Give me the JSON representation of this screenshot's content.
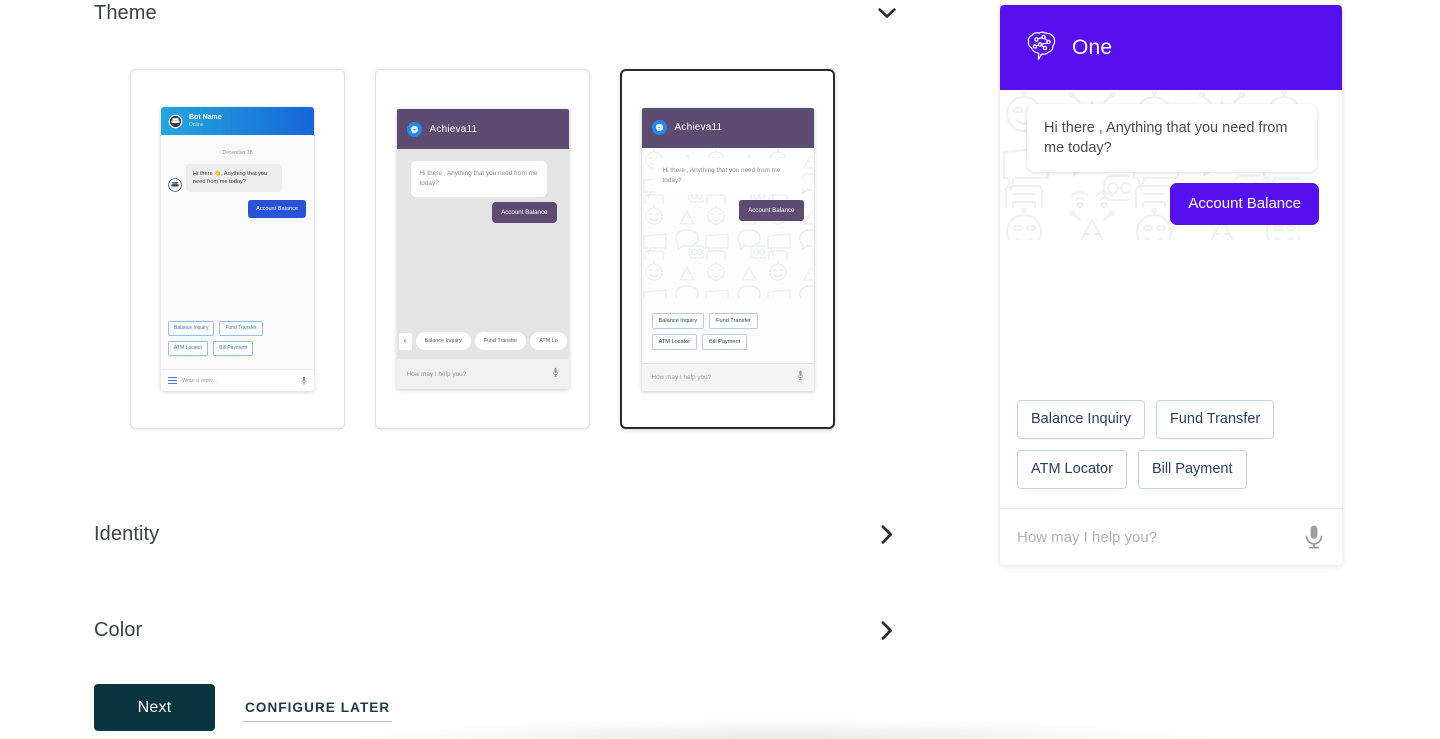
{
  "sections": {
    "theme": {
      "title": "Theme",
      "chevron": "chevron-down-icon",
      "expanded": true
    },
    "identity": {
      "title": "Identity",
      "chevron": "chevron-right-icon",
      "expanded": false
    },
    "color": {
      "title": "Color",
      "chevron": "chevron-right-icon",
      "expanded": false
    }
  },
  "actions": {
    "next_label": "Next",
    "configure_later_label": "CONFIGURE LATER",
    "next_bg": "#08353f"
  },
  "theme_cards": [
    {
      "id": "theme-classic-blue",
      "selected": false,
      "header": {
        "bot_name": "Bot Name",
        "status": "Online",
        "avatar_icon": "robot-avatar-icon",
        "bg_from": "#23a7e0",
        "bg_to": "#1565d8"
      },
      "datestamp": "December 18",
      "bot_message": "Hi there 👋, Anything that you need from me today?",
      "user_message": "Account Balance",
      "quick_replies": [
        "Balance Inquiry",
        "Fund Transfer",
        "ATM Locator",
        "Bill Payment"
      ],
      "input_placeholder": "Write a reply...",
      "menu_icon": "hamburger-menu-icon",
      "mic_icon": "microphone-icon",
      "accent": "#2a52d4"
    },
    {
      "id": "theme-purple-flat",
      "selected": false,
      "header": {
        "bot_name": "Achieva11",
        "avatar_icon": "messenger-bolt-icon",
        "bg": "#5d4b71"
      },
      "bot_message": "Hi there , Anything that you need from me today?",
      "user_message": "Account Balance",
      "quick_replies": [
        "Balance Inquiry",
        "Fund Transfer",
        "ATM Lo"
      ],
      "carousel_prev_icon": "chevron-left-icon",
      "carousel_next_icon": "chevron-right-icon",
      "carousel_arrow_color": "#e8396b",
      "input_placeholder": "How may I help you?",
      "mic_icon": "microphone-icon",
      "accent": "#5d4b71"
    },
    {
      "id": "theme-purple-pattern",
      "selected": true,
      "header": {
        "bot_name": "Achieva11",
        "avatar_icon": "messenger-bolt-icon",
        "bg": "#5d4b71"
      },
      "bot_message": "Hi there , Anything that you need from me today?",
      "user_message": "Account Balance",
      "quick_replies": [
        "Balance Inquiry",
        "Fund Transfer",
        "ATM Locator",
        "Bill Payment"
      ],
      "input_placeholder": "How may I help you?",
      "mic_icon": "microphone-icon",
      "accent": "#5d4b71",
      "wallpaper": "robot-pattern"
    }
  ],
  "preview": {
    "header": {
      "title": "One",
      "logo_icon": "brain-circuit-icon",
      "bg": "#5610f0"
    },
    "bot_message": "Hi there , Anything that you need from me today?",
    "user_message": "Account Balance",
    "quick_replies": [
      [
        "Balance Inquiry",
        "Fund Transfer"
      ],
      [
        "ATM Locator",
        "Bill Payment"
      ]
    ],
    "input_placeholder": "How may I help you?",
    "input_value": "",
    "mic_icon": "microphone-icon",
    "wallpaper": "robot-pattern",
    "accent": "#5610f0",
    "qr_text_color": "#2c3e5d",
    "qr_border_color": "#c3d3e8"
  }
}
